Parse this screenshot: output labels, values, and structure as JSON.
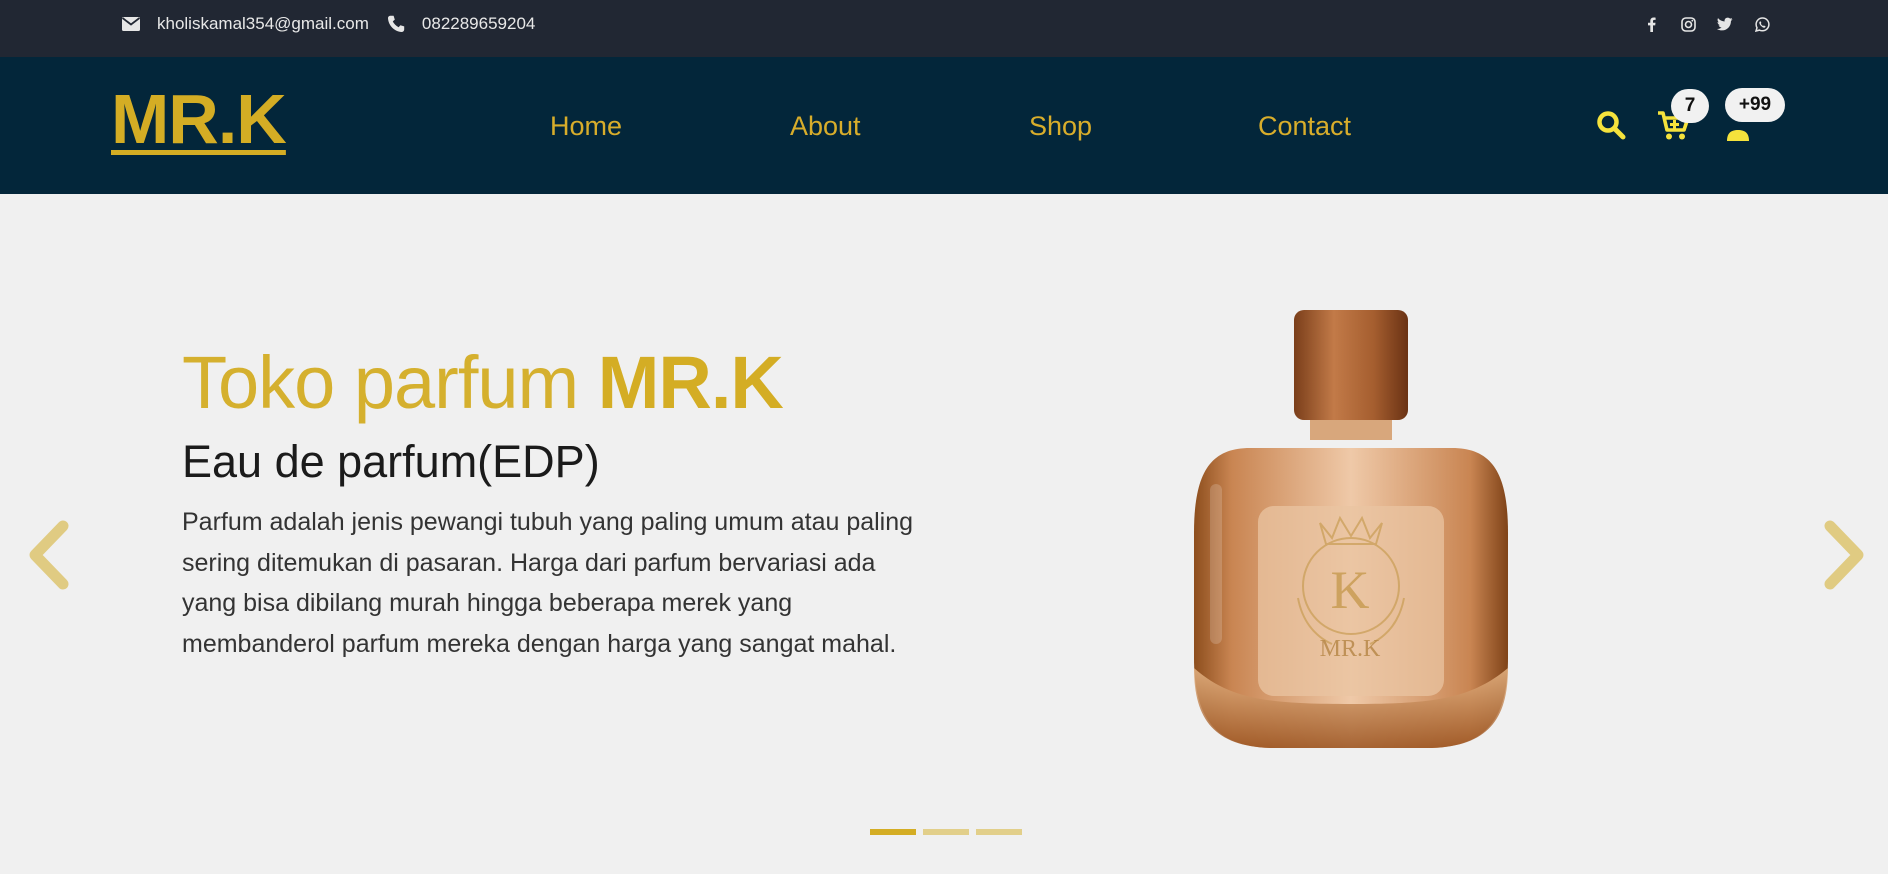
{
  "topbar": {
    "email": "kholiskamal354@gmail.com",
    "phone": "082289659204",
    "social_icons": [
      "facebook-icon",
      "instagram-icon",
      "twitter-icon",
      "whatsapp-icon"
    ]
  },
  "navbar": {
    "logo": "MR.K",
    "links": [
      "Home",
      "About",
      "Shop",
      "Contact"
    ],
    "cart_count": "7",
    "user_count": "+99",
    "icons": [
      "search-icon",
      "cart-icon",
      "user-icon"
    ]
  },
  "hero": {
    "title_light": "Toko parfum",
    "title_bold": "MR.K",
    "subtitle": "Eau de parfum(EDP)",
    "description": "Parfum adalah jenis pewangi tubuh yang paling umum atau paling sering ditemukan di pasaran. Harga dari parfum bervariasi ada yang bisa dibilang murah hingga beberapa merek yang membanderol parfum mereka dengan harga yang sangat mahal.",
    "image_logo_text": "MR.K",
    "active_slide": 1,
    "total_slides": 3
  },
  "colors": {
    "accent": "#d4ad24",
    "topbar_bg": "#212733",
    "navbar_bg": "#03263a",
    "page_bg": "#f0f0f0"
  }
}
